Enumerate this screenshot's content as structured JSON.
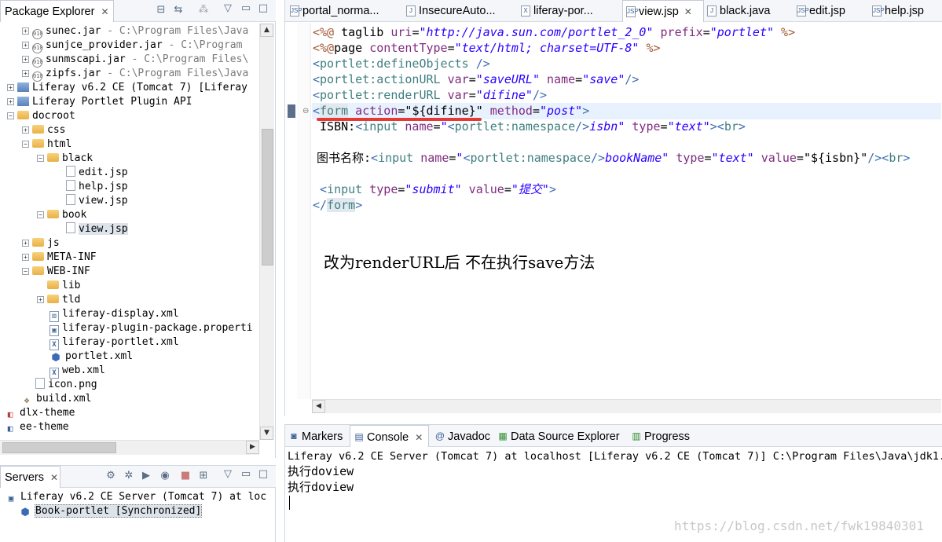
{
  "package_explorer": {
    "title": "Package Explorer",
    "tree": [
      {
        "label": "sunec.jar",
        "suffix": " - C:\\Program Files\\Java",
        "icon": "jar-icon"
      },
      {
        "label": "sunjce_provider.jar",
        "suffix": " - C:\\Program",
        "icon": "jar-icon"
      },
      {
        "label": "sunmscapi.jar",
        "suffix": " - C:\\Program Files\\",
        "icon": "jar-icon"
      },
      {
        "label": "zipfs.jar",
        "suffix": " - C:\\Program Files\\Java",
        "icon": "jar-icon"
      },
      {
        "label": "Liferay v6.2 CE (Tomcat 7) [Liferay",
        "suffix": "",
        "icon": "library-icon"
      },
      {
        "label": "Liferay Portlet Plugin API",
        "suffix": "",
        "icon": "library-icon"
      },
      {
        "label": "docroot",
        "suffix": "",
        "icon": "folder-icon"
      },
      {
        "label": "css",
        "suffix": "",
        "icon": "folder-icon"
      },
      {
        "label": "html",
        "suffix": "",
        "icon": "folder-icon"
      },
      {
        "label": "black",
        "suffix": "",
        "icon": "folder-icon"
      },
      {
        "label": "edit.jsp",
        "suffix": "",
        "icon": "file-icon"
      },
      {
        "label": "help.jsp",
        "suffix": "",
        "icon": "file-icon"
      },
      {
        "label": "view.jsp",
        "suffix": "",
        "icon": "file-icon"
      },
      {
        "label": "book",
        "suffix": "",
        "icon": "folder-icon"
      },
      {
        "label": "view.jsp",
        "suffix": "",
        "icon": "file-icon"
      },
      {
        "label": "js",
        "suffix": "",
        "icon": "folder-icon"
      },
      {
        "label": "META-INF",
        "suffix": "",
        "icon": "folder-icon"
      },
      {
        "label": "WEB-INF",
        "suffix": "",
        "icon": "folder-icon"
      },
      {
        "label": "lib",
        "suffix": "",
        "icon": "folder-icon"
      },
      {
        "label": "tld",
        "suffix": "",
        "icon": "folder-icon"
      },
      {
        "label": "liferay-display.xml",
        "suffix": "",
        "icon": "xml-icon"
      },
      {
        "label": "liferay-plugin-package.properti",
        "suffix": "",
        "icon": "properties-icon"
      },
      {
        "label": "liferay-portlet.xml",
        "suffix": "",
        "icon": "xml-icon"
      },
      {
        "label": "portlet.xml",
        "suffix": "",
        "icon": "portlet-icon"
      },
      {
        "label": "web.xml",
        "suffix": "",
        "icon": "xml-icon"
      },
      {
        "label": "icon.png",
        "suffix": "",
        "icon": "image-icon"
      },
      {
        "label": "build.xml",
        "suffix": "",
        "icon": "ant-icon"
      },
      {
        "label": "dlx-theme",
        "suffix": "",
        "icon": "project-icon"
      },
      {
        "label": "ee-theme",
        "suffix": "",
        "icon": "project-icon"
      }
    ]
  },
  "servers": {
    "title": "Servers",
    "items": [
      {
        "label": "Liferay v6.2 CE Server (Tomcat 7) at loc"
      },
      {
        "label": "Book-portlet  [Synchronized]"
      }
    ]
  },
  "editor": {
    "tabs": [
      {
        "label": "portal_norma...",
        "icon": "jsp-file-icon"
      },
      {
        "label": "InsecureAuto...",
        "icon": "java-file-icon"
      },
      {
        "label": "liferay-por...",
        "icon": "xml-file-icon"
      },
      {
        "label": "view.jsp",
        "icon": "jsp-file-icon",
        "active": true
      },
      {
        "label": "black.java",
        "icon": "java-file-icon"
      },
      {
        "label": "edit.jsp",
        "icon": "jsp-file-icon"
      },
      {
        "label": "help.jsp",
        "icon": "jsp-file-icon"
      }
    ],
    "code": {
      "l1": [
        "<%@",
        " taglib ",
        "uri",
        "=",
        "\"http://java.sun.com/portlet_2_0\"",
        " prefix",
        "=",
        "\"portlet\"",
        " %>"
      ],
      "l2": [
        "<%@",
        "page ",
        "contentType",
        "=",
        "\"text/html; charset=UTF-8\"",
        " %>"
      ],
      "l3": [
        "<",
        "portlet:defineObjects",
        " />"
      ],
      "l4": [
        "<",
        "portlet:actionURL",
        " var",
        "=",
        "\"saveURL\"",
        " name",
        "=",
        "\"save\"",
        "/>"
      ],
      "l5": [
        "<",
        "portlet:renderURL",
        " var",
        "=",
        "\"difine\"",
        "/>"
      ],
      "l6": [
        "<",
        "form",
        " action",
        "=",
        "\"",
        "${difine}",
        "\"",
        " method",
        "=",
        "\"post\"",
        ">"
      ],
      "l7": [
        " ISBN:",
        "<",
        "input",
        " name",
        "=",
        "\"",
        "<",
        "portlet:namespace",
        "/>",
        "isbn\"",
        " type",
        "=",
        "\"text\"",
        ">",
        "<",
        "br",
        ">"
      ],
      "l8": [
        "图书名称:",
        "<",
        "input",
        " name",
        "=",
        "\"",
        "<",
        "portlet:namespace",
        "/>",
        "bookName\"",
        " type",
        "=",
        "\"text\"",
        " value",
        "=",
        "\"",
        "${isbn}",
        "\"",
        "/>",
        "<",
        "br",
        ">"
      ],
      "l9": [
        " ",
        "<",
        "input",
        " type",
        "=",
        "\"submit\"",
        " value",
        "=",
        "\"提交\"",
        ">"
      ],
      "l10": [
        "</",
        "form",
        ">"
      ]
    },
    "annotation": "改为renderURL后 不在执行save方法"
  },
  "console": {
    "tabs": [
      {
        "label": "Markers",
        "icon": "markers-icon"
      },
      {
        "label": "Console",
        "icon": "console-icon",
        "active": true
      },
      {
        "label": "Javadoc",
        "icon": "javadoc-icon"
      },
      {
        "label": "Data Source Explorer",
        "icon": "data-source-icon"
      },
      {
        "label": "Progress",
        "icon": "progress-icon"
      }
    ],
    "header": "Liferay v6.2 CE Server (Tomcat 7) at localhost [Liferay v6.2 CE (Tomcat 7)] C:\\Program Files\\Java\\jdk1.7",
    "lines": [
      "执行doview",
      "执行doview"
    ],
    "watermark": "https://blog.csdn.net/fwk19840301"
  },
  "colors": {
    "underline": "#e53935",
    "tag": "#3f6fb1",
    "attr": "#7f2b7f",
    "value": "#2a00ff"
  }
}
